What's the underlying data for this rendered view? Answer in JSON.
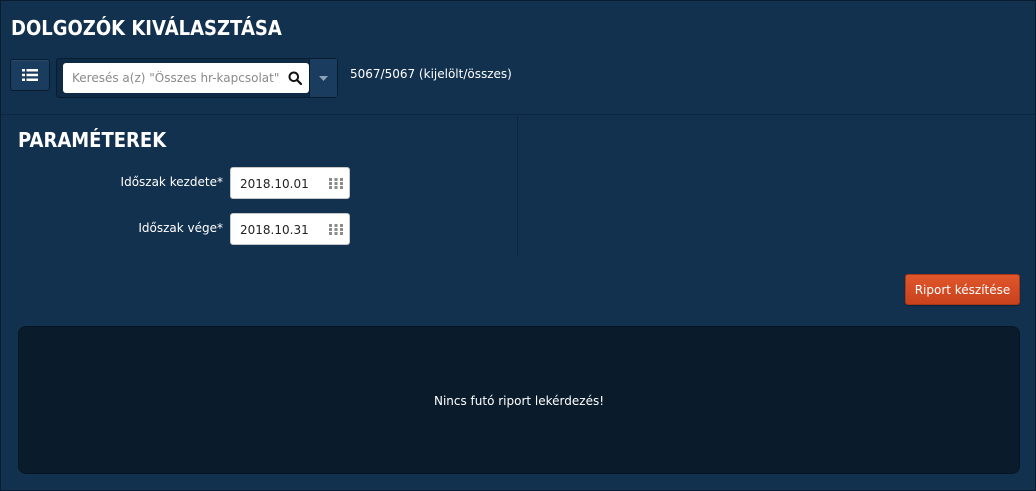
{
  "header": {
    "title": "DOLGOZÓK KIVÁLASZTÁSA"
  },
  "toolbar": {
    "list_icon": "list-icon",
    "search_placeholder": "Keresés a(z) \"Összes hr-kapcsolat\" elemei között",
    "search_icon": "search-icon",
    "dropdown_icon": "caret-down-icon",
    "count_text": "5067/5067 (kijelölt/összes)"
  },
  "params": {
    "title": "PARAMÉTEREK",
    "start": {
      "label": "Időszak kezdete*",
      "value": "2018.10.01",
      "icon": "calendar-icon"
    },
    "end": {
      "label": "Időszak vége*",
      "value": "2018.10.31",
      "icon": "calendar-icon"
    }
  },
  "actions": {
    "report_button": "Riport készítése"
  },
  "result": {
    "message": "Nincs futó riport lekérdezés!"
  },
  "colors": {
    "background": "#12314f",
    "panel_dark": "#0a1c2b",
    "accent_button": "#d44c24"
  }
}
